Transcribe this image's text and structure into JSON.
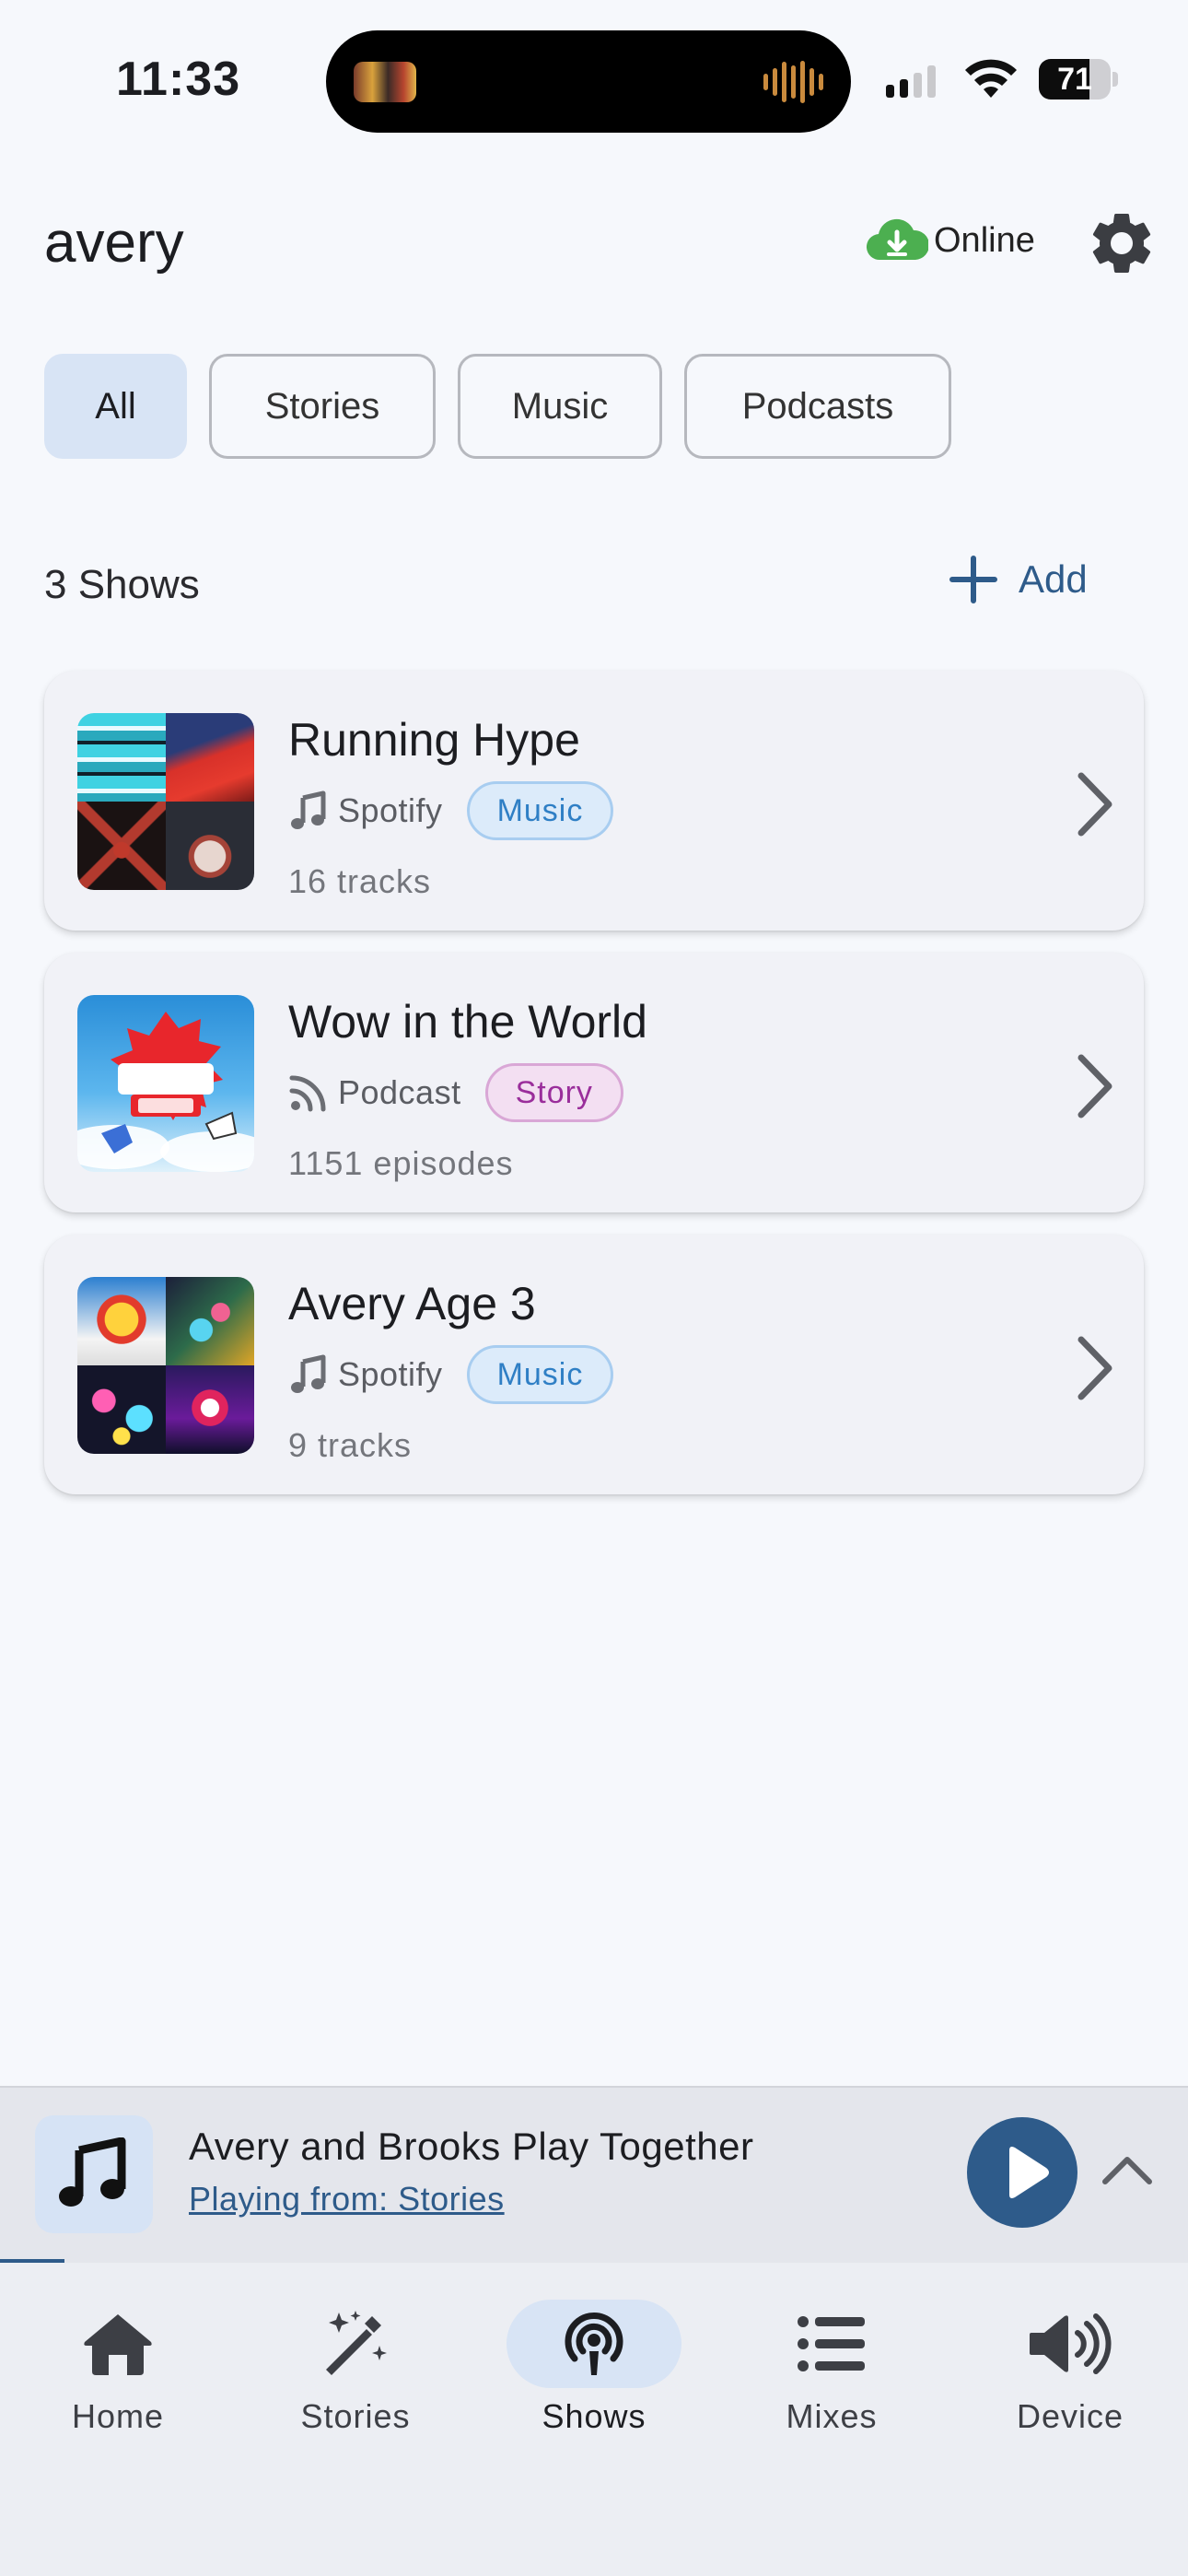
{
  "status_bar": {
    "time": "11:33",
    "battery": "71",
    "battery_level": 0.71,
    "signal_bars": 2,
    "icons": [
      "now-playing-thumbnail",
      "audio-waveform-icon",
      "cellular-signal-icon",
      "wifi-icon",
      "battery-icon"
    ]
  },
  "header": {
    "title": "avery",
    "status": "Online",
    "status_icon": "cloud-download-icon",
    "status_color": "#4caf50",
    "settings_icon": "gear-icon"
  },
  "filters": [
    {
      "label": "All",
      "active": true
    },
    {
      "label": "Stories",
      "active": false
    },
    {
      "label": "Music",
      "active": false
    },
    {
      "label": "Podcasts",
      "active": false
    }
  ],
  "section": {
    "count_label": "3 Shows",
    "add_label": "Add",
    "add_icon": "plus-icon"
  },
  "shows": [
    {
      "title": "Running Hype",
      "source": "Spotify",
      "source_icon": "music-note-icon",
      "tag": "Music",
      "count": "16 tracks"
    },
    {
      "title": "Wow in the World",
      "source": "Podcast",
      "source_icon": "rss-feed-icon",
      "tag": "Story",
      "count": "1151 episodes"
    },
    {
      "title": "Avery Age 3",
      "source": "Spotify",
      "source_icon": "music-note-icon",
      "tag": "Music",
      "count": "9 tracks"
    }
  ],
  "player": {
    "title": "Avery and Brooks Play Together",
    "source": "Playing from: Stories",
    "progress": 0.054,
    "art_icon": "music-note-icon",
    "play_icon": "play-icon",
    "expand_icon": "chevron-up-icon"
  },
  "nav": [
    {
      "label": "Home",
      "icon": "home-icon",
      "active": false
    },
    {
      "label": "Stories",
      "icon": "magic-wand-icon",
      "active": false
    },
    {
      "label": "Shows",
      "icon": "podcast-icon",
      "active": true
    },
    {
      "label": "Mixes",
      "icon": "list-icon",
      "active": false
    },
    {
      "label": "Device",
      "icon": "speaker-icon",
      "active": false
    }
  ],
  "colors": {
    "accent": "#2e5b8a",
    "chip_active": "#d8e4f5",
    "music_tag": "#2f7fc5",
    "story_tag": "#9a2e9b",
    "background": "#f6f8fc"
  }
}
